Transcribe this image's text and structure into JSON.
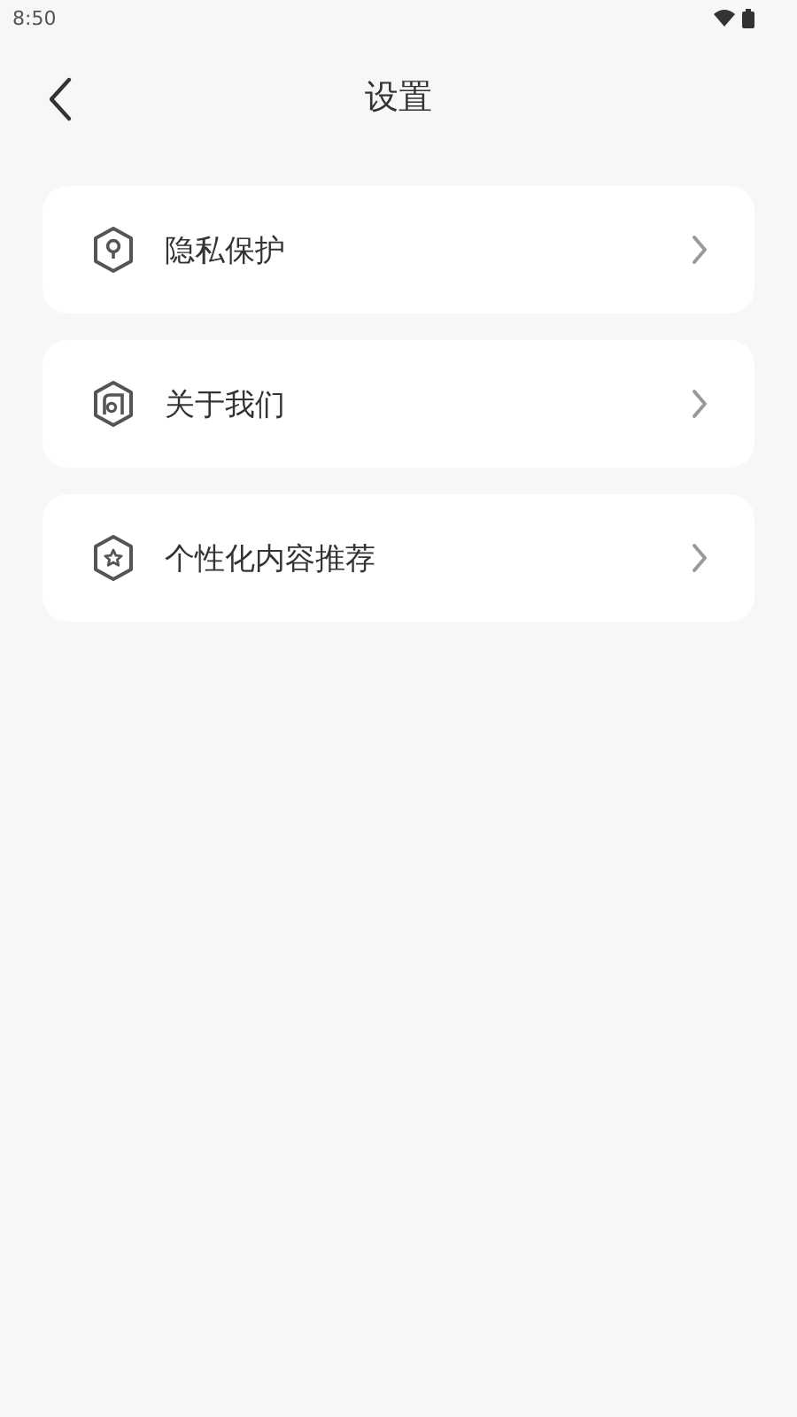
{
  "status_bar": {
    "time": "8:50"
  },
  "header": {
    "title": "设置"
  },
  "items": [
    {
      "label": "隐私保护",
      "kind": "lock"
    },
    {
      "label": "关于我们",
      "kind": "about"
    },
    {
      "label": "个性化内容推荐",
      "kind": "star"
    }
  ]
}
